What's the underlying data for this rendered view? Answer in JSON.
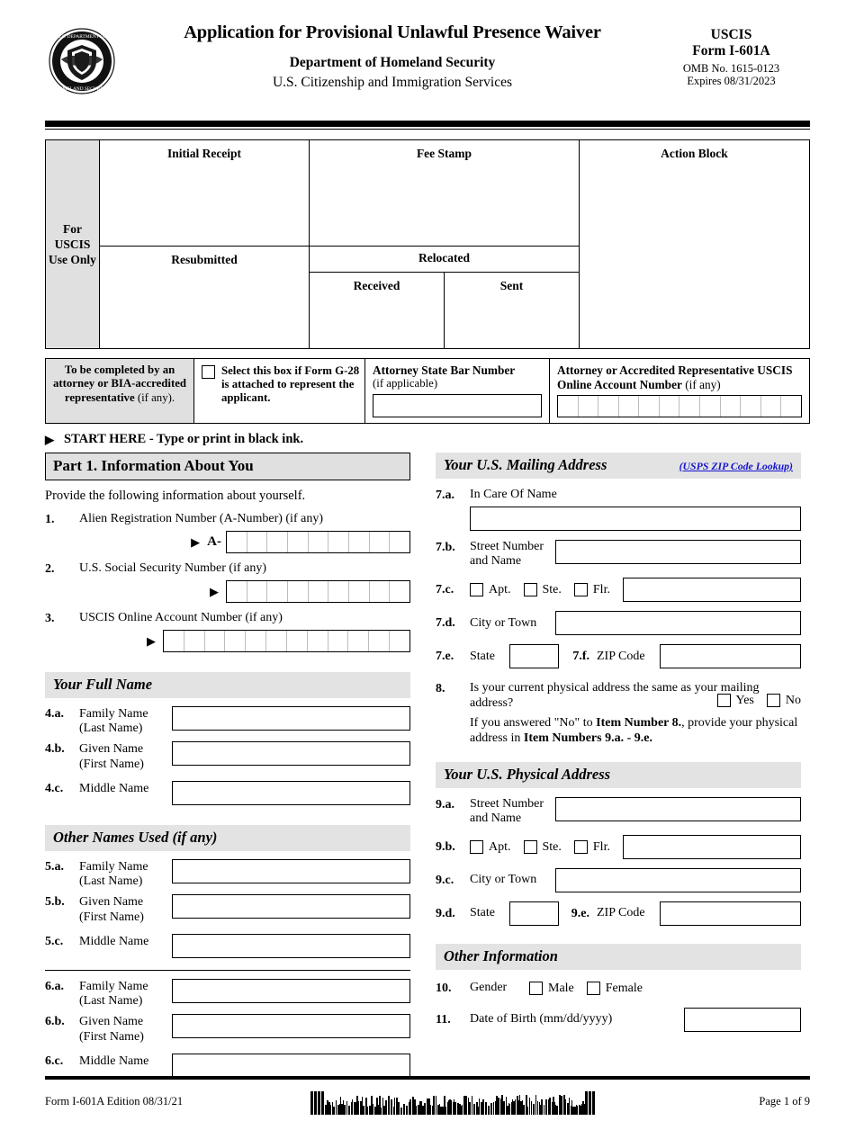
{
  "header": {
    "seal_alt": "dhs-seal",
    "title": "Application for Provisional Unlawful Presence Waiver",
    "department": "Department of Homeland Security",
    "agency": "U.S. Citizenship and Immigration Services",
    "uscis": "USCIS",
    "form_number": "Form I-601A",
    "omb": "OMB No. 1615-0123",
    "expires": "Expires 08/31/2023"
  },
  "uscis_use_only": {
    "side_label": "For USCIS Use Only",
    "initial_receipt": "Initial Receipt",
    "fee_stamp": "Fee Stamp",
    "action_block": "Action Block",
    "resubmitted": "Resubmitted",
    "relocated": "Relocated",
    "received": "Received",
    "sent": "Sent"
  },
  "attorney": {
    "left_label_bold": "To be completed by an attorney or BIA-accredited representative",
    "left_label_light": " (if any).",
    "checkbox_label": "Select this box if Form G-28 is attached to represent the applicant.",
    "bar_number_label": "Attorney State Bar Number",
    "bar_number_sub": "(if applicable)",
    "bar_number_value": "",
    "online_account_label": "Attorney or Accredited Representative USCIS Online Account Number",
    "online_account_light": " (if any)",
    "online_account_cells": 12,
    "online_account_value": ""
  },
  "start_here": "START HERE - Type or print in black ink.",
  "part1": {
    "heading": "Part 1.  Information About You",
    "intro": "Provide the following information about yourself.",
    "items": [
      {
        "num": "1.",
        "label": "Alien Registration Number (A-Number) (if any)",
        "prefix": "A-",
        "cells": 9,
        "value": ""
      },
      {
        "num": "2.",
        "label": "U.S. Social Security Number (if any)",
        "prefix": "",
        "cells": 9,
        "value": ""
      },
      {
        "num": "3.",
        "label": "USCIS Online Account Number (if any)",
        "prefix": "",
        "cells": 12,
        "value": ""
      }
    ],
    "full_name_heading": "Your Full Name",
    "full_name": [
      {
        "num": "4.a.",
        "label": "Family Name\n(Last Name)",
        "value": ""
      },
      {
        "num": "4.b.",
        "label": "Given Name\n(First Name)",
        "value": ""
      },
      {
        "num": "4.c.",
        "label": "Middle Name",
        "value": ""
      }
    ],
    "other_names_heading_bold": "Other Names Used ",
    "other_names_heading_light": "(if any)",
    "other_names_1": [
      {
        "num": "5.a.",
        "label": "Family Name\n(Last Name)",
        "value": ""
      },
      {
        "num": "5.b.",
        "label": "Given Name\n(First Name)",
        "value": ""
      },
      {
        "num": "5.c.",
        "label": "Middle Name",
        "value": ""
      }
    ],
    "other_names_2": [
      {
        "num": "6.a.",
        "label": "Family Name\n(Last Name)",
        "value": ""
      },
      {
        "num": "6.b.",
        "label": "Given Name\n(First Name)",
        "value": ""
      },
      {
        "num": "6.c.",
        "label": "Middle Name",
        "value": ""
      }
    ]
  },
  "mailing": {
    "heading": "Your U.S. Mailing Address",
    "zip_link": "(USPS ZIP Code Lookup)",
    "in_care_of": {
      "num": "7.a.",
      "label": "In Care Of Name",
      "value": ""
    },
    "street": {
      "num": "7.b.",
      "label": "Street Number\nand Name",
      "value": ""
    },
    "unit": {
      "num": "7.c.",
      "apt": "Apt.",
      "ste": "Ste.",
      "flr": "Flr.",
      "value": ""
    },
    "city": {
      "num": "7.d.",
      "label": "City or Town",
      "value": ""
    },
    "state": {
      "num": "7.e.",
      "label": "State",
      "value": ""
    },
    "zip": {
      "num": "7.f.",
      "label": "ZIP Code",
      "value": ""
    }
  },
  "item8": {
    "num": "8.",
    "question": "Is your current physical address the same as your mailing address?",
    "yes": "Yes",
    "no": "No",
    "note_p1": "If you answered \"No\" to ",
    "note_b1": "Item Number 8.",
    "note_p2": ", provide your physical address in ",
    "note_b2": "Item Numbers 9.a. - 9.e."
  },
  "physical": {
    "heading": "Your U.S. Physical Address",
    "street": {
      "num": "9.a.",
      "label": "Street Number\nand Name",
      "value": ""
    },
    "unit": {
      "num": "9.b.",
      "apt": "Apt.",
      "ste": "Ste.",
      "flr": "Flr.",
      "value": ""
    },
    "city": {
      "num": "9.c.",
      "label": "City or Town",
      "value": ""
    },
    "state": {
      "num": "9.d.",
      "label": "State",
      "value": ""
    },
    "zip": {
      "num": "9.e.",
      "label": "ZIP Code",
      "value": ""
    }
  },
  "other_info": {
    "heading": "Other Information",
    "gender": {
      "num": "10.",
      "label": "Gender",
      "male": "Male",
      "female": "Female"
    },
    "dob": {
      "num": "11.",
      "label": "Date of Birth (mm/dd/yyyy)",
      "value": ""
    }
  },
  "footer": {
    "form_edition": "Form I-601A   Edition   08/31/21",
    "page": "Page 1 of 9",
    "barcode_alt": "form-barcode"
  },
  "colors": {
    "shade": "#e0e0e0",
    "link": "#1414cf",
    "rule": "#000000"
  }
}
